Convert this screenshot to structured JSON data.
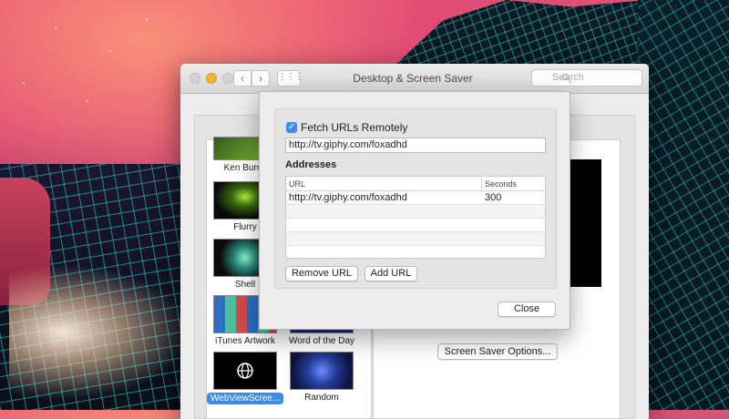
{
  "window": {
    "title": "Desktop & Screen Saver",
    "search_placeholder": "Search",
    "nav_back": "‹",
    "nav_fwd": "›",
    "grid": "⋮⋮⋮"
  },
  "screensavers": [
    {
      "label": "Ken Burns"
    },
    {
      "label": "Flurry"
    },
    {
      "label": "Shell"
    },
    {
      "label": "iTunes Artwork"
    },
    {
      "label": "Word of the Day"
    },
    {
      "label": "WebViewScree..."
    },
    {
      "label": "Random"
    }
  ],
  "options_button": "Screen Saver Options...",
  "sheet": {
    "fetch_checkbox_label": "Fetch URLs Remotely",
    "fetch_checked": true,
    "url_value": "http://tv.giphy.com/foxadhd",
    "addresses_heading": "Addresses",
    "columns": {
      "url": "URL",
      "seconds": "Seconds"
    },
    "rows": [
      {
        "url": "http://tv.giphy.com/foxadhd",
        "seconds": "300"
      }
    ],
    "remove_button": "Remove URL",
    "add_button": "Add URL",
    "close_button": "Close"
  },
  "colors": {
    "accent": "#3b8de5",
    "minimize": "#f5b630"
  }
}
